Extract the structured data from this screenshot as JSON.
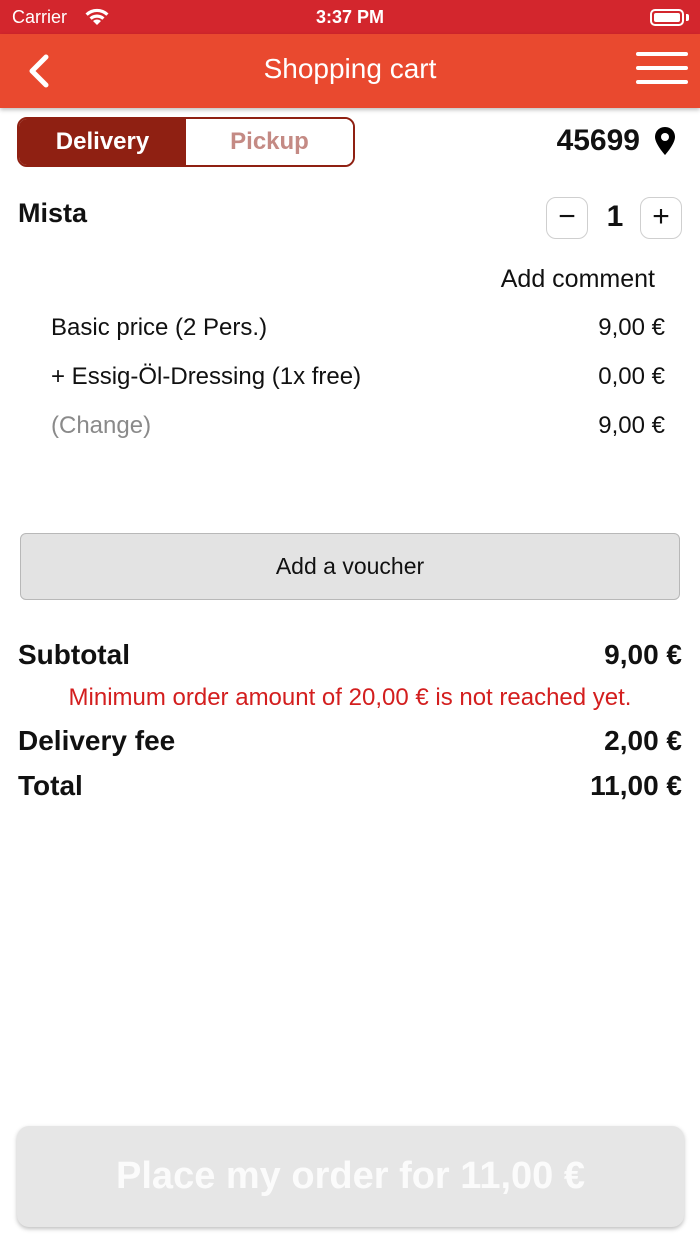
{
  "status_bar": {
    "carrier": "Carrier",
    "time": "3:37 PM",
    "wifi_icon": "wifi-icon",
    "battery_icon": "battery-icon"
  },
  "header": {
    "title": "Shopping cart",
    "back_icon": "chevron-left-icon",
    "menu_icon": "hamburger-menu-icon",
    "background_color": "#e9492f"
  },
  "mode_toggle": {
    "options": [
      "Delivery",
      "Pickup"
    ],
    "selected": "Delivery",
    "active_color": "#8f2012"
  },
  "location": {
    "zip": "45699",
    "icon": "map-pin-icon"
  },
  "cart_item": {
    "name": "Mista",
    "quantity": "1",
    "minus_label": "−",
    "plus_label": "+",
    "add_comment": "Add comment",
    "lines": [
      {
        "label": "Basic price (2 Pers.)",
        "value": "9,00 €"
      },
      {
        "label": "+ Essig-Öl-Dressing (1x free)",
        "value": "0,00 €"
      },
      {
        "label": "(Change)",
        "value": "9,00 €"
      }
    ]
  },
  "voucher_button": "Add a voucher",
  "summary": {
    "subtotal_label": "Subtotal",
    "subtotal_value": "9,00 €",
    "minimum_warning": "Minimum order amount of 20,00 € is not reached yet.",
    "delivery_fee_label": "Delivery fee",
    "delivery_fee_value": "2,00 €",
    "total_label": "Total",
    "total_value": "11,00 €",
    "warning_color": "#d31e1e"
  },
  "order_button": "Place my order for 11,00 €"
}
